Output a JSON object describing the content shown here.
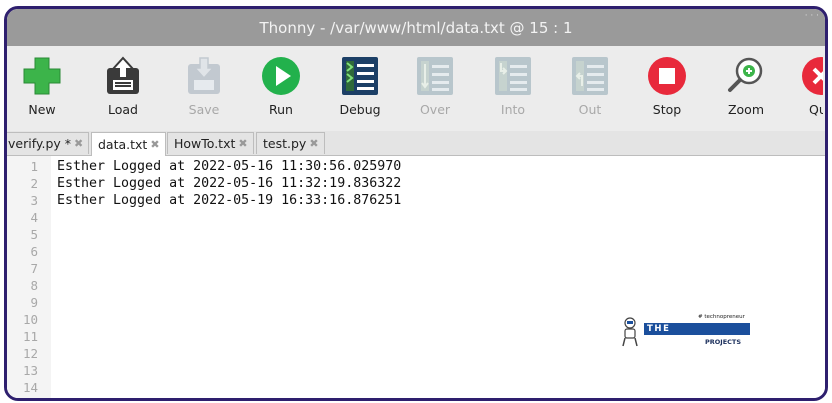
{
  "window": {
    "title": "Thonny  -  /var/www/html/data.txt  @  15 : 1",
    "title_extra": "· ·   ·"
  },
  "toolbar": {
    "buttons": [
      {
        "label": "New",
        "icon": "new-file-icon",
        "enabled": true
      },
      {
        "label": "Load",
        "icon": "load-icon",
        "enabled": true
      },
      {
        "label": "Save",
        "icon": "save-icon",
        "enabled": false
      },
      {
        "label": "Run",
        "icon": "run-icon",
        "enabled": true
      },
      {
        "label": "Debug",
        "icon": "debug-icon",
        "enabled": true
      },
      {
        "label": "Over",
        "icon": "step-over-icon",
        "enabled": false
      },
      {
        "label": "Into",
        "icon": "step-into-icon",
        "enabled": false
      },
      {
        "label": "Out",
        "icon": "step-out-icon",
        "enabled": false
      },
      {
        "label": "Stop",
        "icon": "stop-icon",
        "enabled": true
      },
      {
        "label": "Zoom",
        "icon": "zoom-icon",
        "enabled": true
      },
      {
        "label": "Qu",
        "icon": "quit-icon",
        "enabled": true
      }
    ]
  },
  "tabs": [
    {
      "label": "verify.py *",
      "active": false
    },
    {
      "label": "data.txt",
      "active": true
    },
    {
      "label": "HowTo.txt",
      "active": false
    },
    {
      "label": "test.py",
      "active": false
    }
  ],
  "tab_close_glyph": "✖",
  "editor": {
    "line_numbers": [
      "1",
      "2",
      "3",
      "4",
      "5",
      "6",
      "7",
      "8",
      "9",
      "10",
      "11",
      "12",
      "13",
      "14"
    ],
    "lines": [
      "Esther Logged at 2022-05-16 11:30:56.025970",
      "Esther Logged at 2022-05-16 11:32:19.836322",
      "Esther Logged at 2022-05-19 16:33:16.876251"
    ]
  },
  "watermark": {
    "small": "# technopreneur",
    "main": "THE ENGINEERING",
    "sub": "PROJECTS"
  },
  "colors": {
    "titlebar": "#9a9a9a",
    "toolbar": "#ececec",
    "frame_border": "#2e1f6e",
    "new_green": "#3cb44a",
    "run_green": "#22b14c",
    "stop_red": "#e8293b",
    "debug_blue": "#1c3f66"
  }
}
